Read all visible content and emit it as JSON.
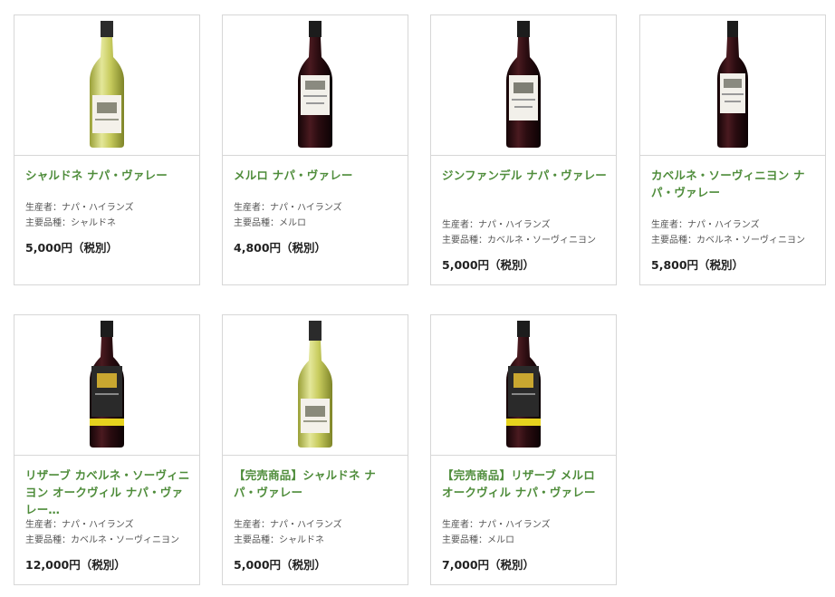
{
  "labels": {
    "producer": "生産者：",
    "grape": "主要品種："
  },
  "products": [
    {
      "name": "シャルドネ ナパ・ヴァレー",
      "producer": "ナパ・ハイランズ",
      "grape": "シャルドネ",
      "price": "5,000円（税別）",
      "bottle": "white-wine-bottle"
    },
    {
      "name": "メルロ ナパ・ヴァレー",
      "producer": "ナパ・ハイランズ",
      "grape": "メルロ",
      "price": "4,800円（税別）",
      "bottle": "red-wine-bottle"
    },
    {
      "name": "ジンファンデル ナパ・ヴァレー",
      "producer": "ナパ・ハイランズ",
      "grape": "カベルネ・ソーヴィニヨン",
      "price": "5,000円（税別）",
      "bottle": "red-wine-bottle"
    },
    {
      "name": "カベルネ・ソーヴィニヨン ナパ・ヴァレー",
      "producer": "ナパ・ハイランズ",
      "grape": "カベルネ・ソーヴィニヨン",
      "price": "5,800円（税別）",
      "bottle": "red-wine-bottle"
    },
    {
      "name": "リザーブ カベルネ・ソーヴィニヨン オークヴィル ナパ・ヴァレー…",
      "producer": "ナパ・ハイランズ",
      "grape": "カベルネ・ソーヴィニヨン",
      "price": "12,000円（税別）",
      "bottle": "reserve-wine-bottle"
    },
    {
      "name": "【完売商品】シャルドネ ナパ・ヴァレー",
      "producer": "ナパ・ハイランズ",
      "grape": "シャルドネ",
      "price": "5,000円（税別）",
      "bottle": "white-wine-bottle"
    },
    {
      "name": "【完売商品】リザーブ メルロ オークヴィル ナパ・ヴァレー",
      "producer": "ナパ・ハイランズ",
      "grape": "メルロ",
      "price": "7,000円（税別）",
      "bottle": "reserve-wine-bottle"
    }
  ],
  "colors": {
    "link_green": "#4e8c3a",
    "border": "#d7d7d7",
    "price": "#222222"
  }
}
